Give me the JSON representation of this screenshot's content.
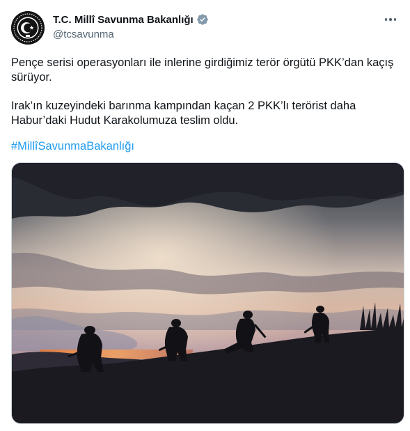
{
  "author": {
    "display_name": "T.C. Millî Savunma Bakanlığı",
    "handle": "@tcsavunma",
    "avatar_icon": "ministry-emblem-icon",
    "verified_icon": "verified-badge-icon"
  },
  "tweet": {
    "paragraph_1": "Pençe serisi operasyonları ile inlerine girdiğimiz terör örgütü PKK’dan kaçış sürüyor.",
    "paragraph_2": "Irak’ın kuzeyindeki barınma kampından kaçan 2 PKK’lı terörist daha Habur’daki Hudut Karakolumuza teslim oldu.",
    "hashtag": "#MillîSavunmaBakanlığı"
  },
  "colors": {
    "link": "#1d9bf0",
    "text": "#0f1419",
    "secondary": "#536471",
    "verified": "#829aab"
  },
  "menu": {
    "more_icon": "more-options-icon"
  },
  "media": {
    "content": "silhouettes-of-soldiers-at-sunset-photo"
  }
}
